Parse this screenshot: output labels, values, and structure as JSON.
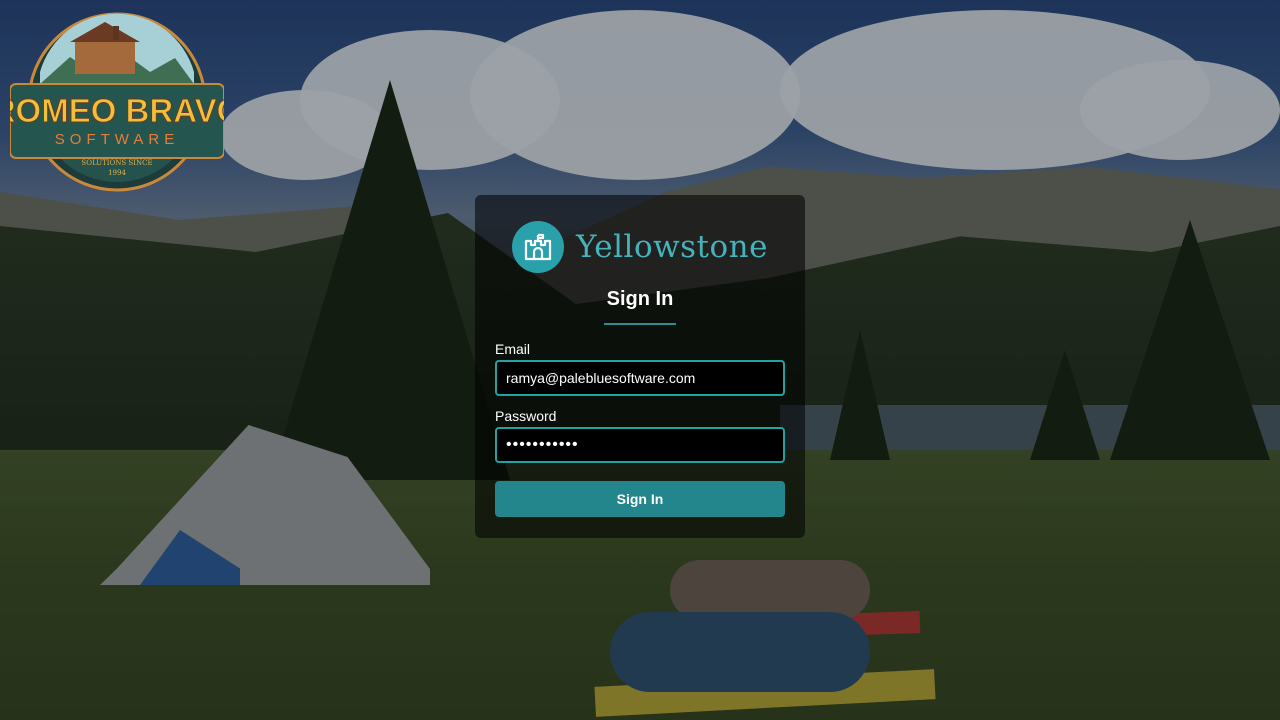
{
  "logo": {
    "line1": "ROMEO BRAVO",
    "line2": "SOFTWARE",
    "tagline": "SOLUTIONS SINCE",
    "year": "1994"
  },
  "brand": {
    "icon": "castle-icon",
    "name": "Yellowstone"
  },
  "login": {
    "title": "Sign In",
    "email_label": "Email",
    "email_value": "ramya@palebluesoftware.com",
    "password_label": "Password",
    "password_value": "•••••••••••",
    "submit_label": "Sign In"
  },
  "colors": {
    "accent": "#2aa0ab",
    "brand_text": "#45b3bc",
    "button": "#23868c",
    "input_border": "#23a2a4"
  }
}
